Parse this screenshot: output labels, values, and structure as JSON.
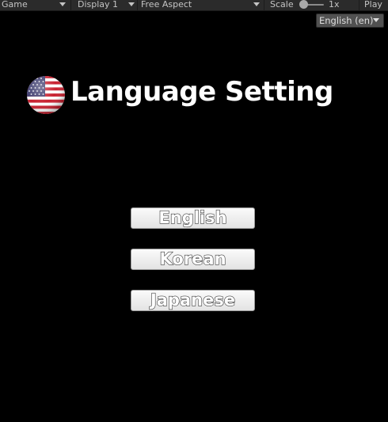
{
  "toolbar": {
    "view": "Game",
    "display": "Display 1",
    "aspect": "Free Aspect",
    "scale_label": "Scale",
    "scale_value": "1x",
    "play": "Play"
  },
  "language_dropdown": {
    "selected": "English (en)"
  },
  "title": {
    "text": "Language Setting",
    "flag_icon": "us-flag-icon"
  },
  "buttons": [
    {
      "label": "English"
    },
    {
      "label": "Korean"
    },
    {
      "label": "Japanese"
    }
  ],
  "colors": {
    "background": "#000000",
    "toolbar": "#2b2b2b",
    "dropdown": "#515151",
    "button_face": "#f0f0f0",
    "flag_red": "#c8202f",
    "flag_blue": "#3c3b6e"
  }
}
